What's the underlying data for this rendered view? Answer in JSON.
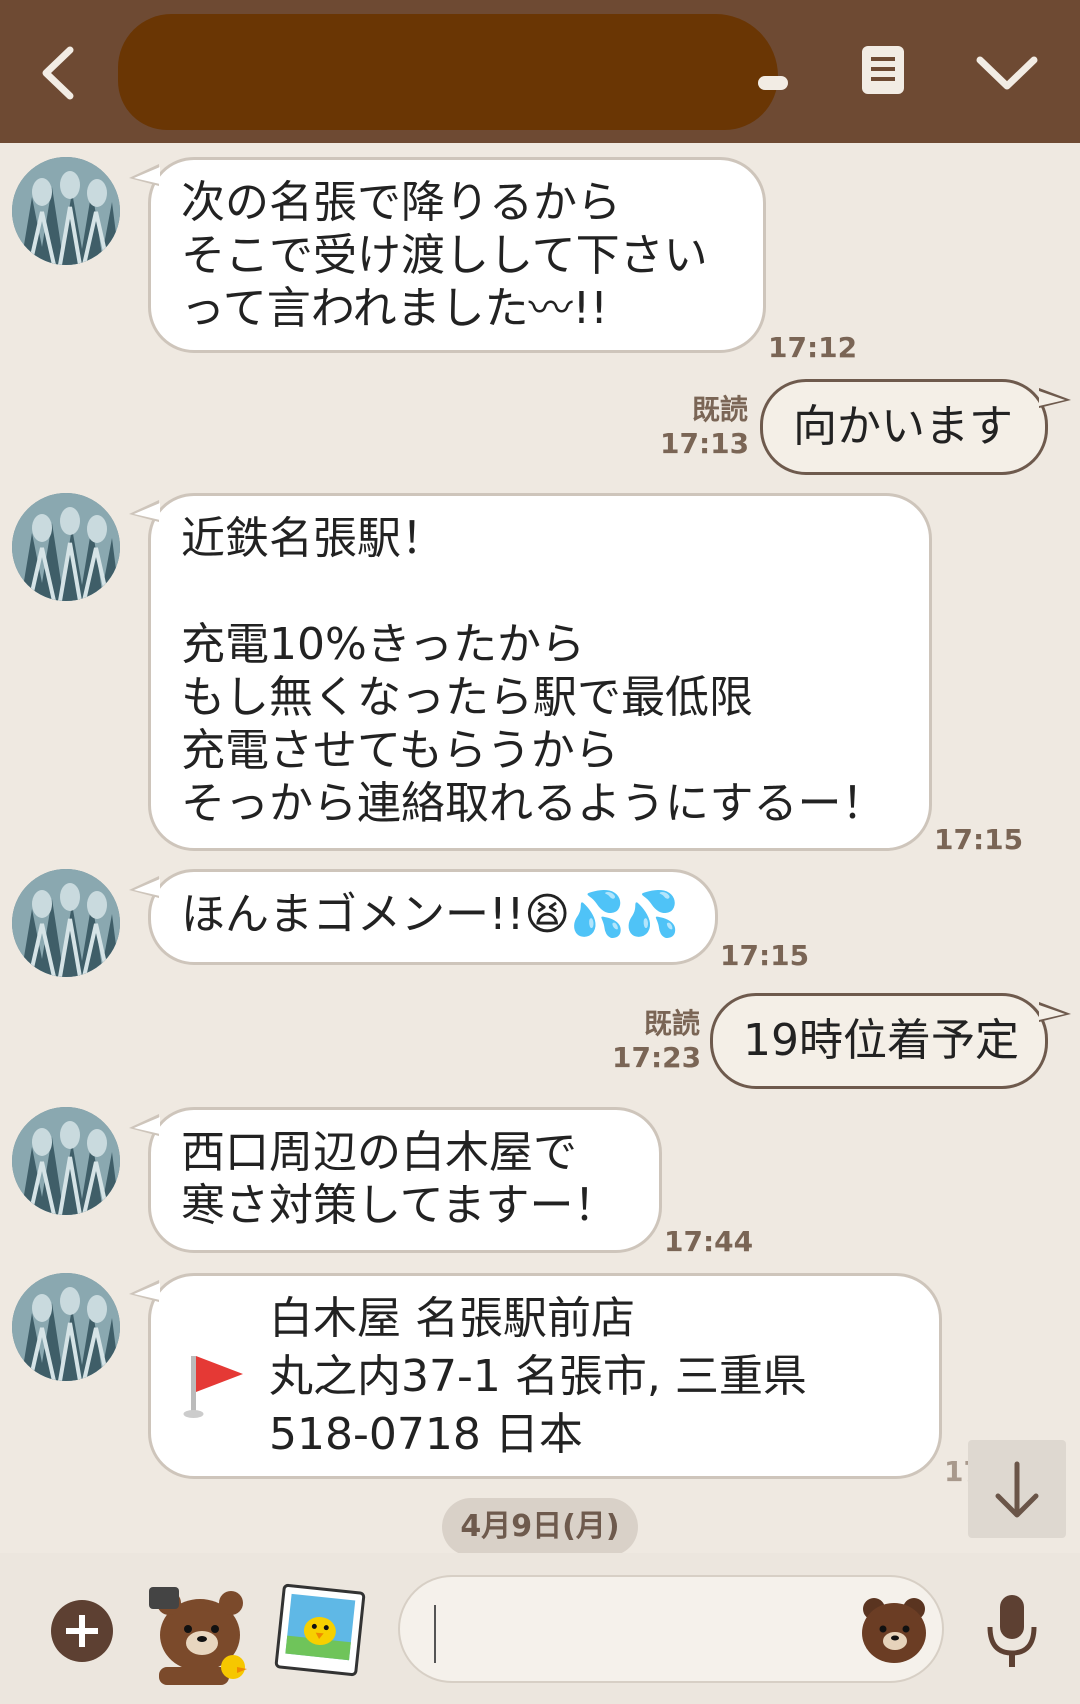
{
  "header": {},
  "messages": [
    {
      "lines": [
        "次の名張で降りるから",
        "そこで受け渡しして下さい",
        "って言われました〰!!"
      ],
      "time": "17:12"
    },
    {
      "text": "向かいます",
      "read": "既読",
      "time": "17:13"
    },
    {
      "lines": [
        "近鉄名張駅！",
        "",
        "充電10%きったから",
        "もし無くなったら駅で最低限",
        "充電させてもらうから",
        "そっから連絡取れるようにするー！"
      ],
      "time": "17:15"
    },
    {
      "text": "ほんまゴメンー!!",
      "emoji": "😫💦💦",
      "time": "17:15"
    },
    {
      "text": "19時位着予定",
      "read": "既読",
      "time": "17:23"
    },
    {
      "lines": [
        "西口周辺の白木屋で",
        "寒さ対策してますー！"
      ],
      "time": "17:44"
    },
    {
      "location": {
        "name": "白木屋 名張駅前店",
        "address1": "丸之内37-1 名張市, 三重県",
        "address2": "518-0718 日本"
      },
      "time": "17:56"
    }
  ],
  "date_separator": "4月9日(月)",
  "footer": {
    "input_value": ""
  },
  "colors": {
    "header": "#6e4a33",
    "background": "#efe9e1",
    "accent": "#5d4032"
  }
}
